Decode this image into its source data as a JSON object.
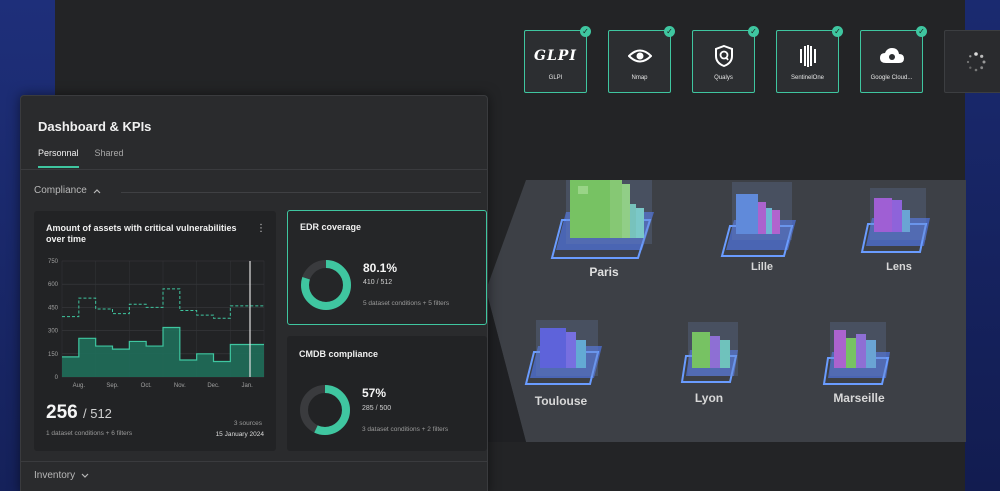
{
  "integrations": [
    {
      "label": "GLPI",
      "logo_text": "GLPI",
      "icon": "glpi-logo-icon",
      "status": "connected"
    },
    {
      "label": "Nmap",
      "icon": "eye-icon",
      "status": "connected"
    },
    {
      "label": "Qualys",
      "icon": "qualys-shield-icon",
      "status": "connected"
    },
    {
      "label": "SentinelOne",
      "icon": "sentinelone-icon",
      "status": "connected"
    },
    {
      "label": "Google Cloud...",
      "icon": "cloud-icon",
      "status": "connected"
    }
  ],
  "loading_tile": {
    "icon": "spinner-icon"
  },
  "sites": [
    {
      "name": "Paris"
    },
    {
      "name": "Lille"
    },
    {
      "name": "Lens"
    },
    {
      "name": "Toulouse"
    },
    {
      "name": "Lyon"
    },
    {
      "name": "Marseille"
    }
  ],
  "dashboard": {
    "title": "Dashboard & KPIs",
    "tabs": [
      {
        "label": "Personnal",
        "active": true
      },
      {
        "label": "Shared",
        "active": false
      }
    ],
    "sections": {
      "compliance": "Compliance",
      "inventory": "Inventory"
    },
    "vuln_card": {
      "title_line1": "Amount of assets with critical vulnerabilities",
      "title_line2": "over time",
      "value": "256",
      "denominator": "/ 512",
      "conditions": "1 dataset conditions + 6 filters",
      "sources": "3 sources",
      "date": "15 January 2024"
    },
    "edr_card": {
      "title": "EDR coverage",
      "percent": "80.1%",
      "fraction": "410 / 512",
      "conditions": "5 dataset conditions + 5 filters",
      "value_pct": 80.1
    },
    "cmdb_card": {
      "title": "CMDB compliance",
      "percent": "57%",
      "fraction": "285 / 500",
      "conditions": "3 dataset conditions + 2 filters",
      "value_pct": 57
    }
  },
  "colors": {
    "accent": "#3fc6a0",
    "panel": "#2a2b2d",
    "card": "#222325"
  },
  "chart_data": {
    "type": "area",
    "y_ticks": [
      "750",
      "600",
      "450",
      "300",
      "150",
      "0"
    ],
    "x_ticks": [
      "Aug.",
      "Sep.",
      "Oct.",
      "Nov.",
      "Dec.",
      "Jan."
    ],
    "ylim": [
      0,
      750
    ],
    "x": [
      0,
      1,
      2,
      3,
      4,
      5,
      6,
      7,
      8,
      9,
      10,
      11
    ],
    "series": [
      {
        "style": "step-area",
        "values": [
          130,
          250,
          200,
          180,
          230,
          200,
          320,
          110,
          150,
          100,
          210,
          210
        ]
      },
      {
        "style": "step-dashed",
        "values": [
          390,
          510,
          440,
          410,
          470,
          450,
          570,
          430,
          400,
          380,
          460,
          460
        ]
      }
    ]
  }
}
